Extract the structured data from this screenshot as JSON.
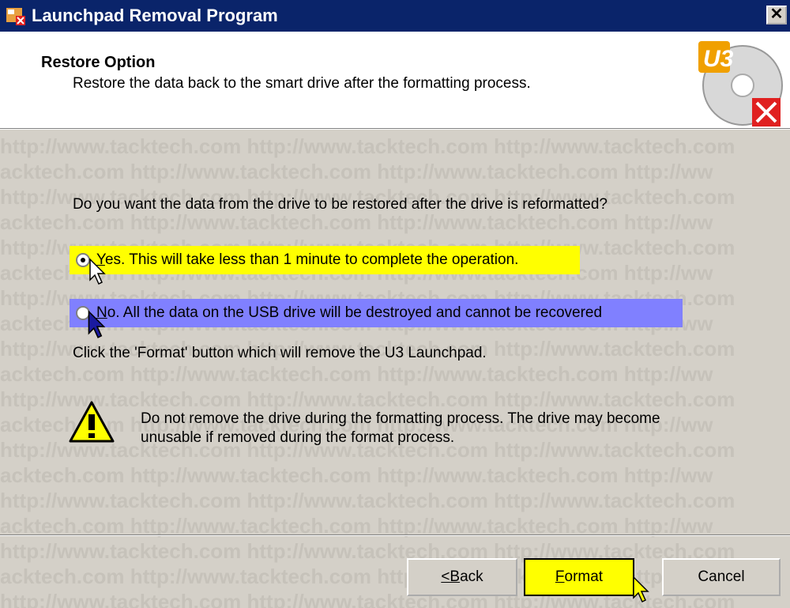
{
  "window": {
    "title": "Launchpad Removal Program",
    "close_glyph": "✕"
  },
  "header": {
    "title": "Restore Option",
    "subtitle": "Restore the data back to the smart drive after the formatting process.",
    "logo_icon": "u3-disc-remove-icon",
    "logo_text": "U3"
  },
  "content": {
    "question": "Do you want the data from the drive to be restored after the drive is reformatted?",
    "option_yes": {
      "accel": "Y",
      "rest": "es. This will take less than 1 minute to complete the operation.",
      "selected": true,
      "highlight_color": "#ffff00"
    },
    "option_no": {
      "accel": "N",
      "rest": "o.  All the data on the USB drive will be destroyed and cannot be recovered",
      "selected": false,
      "highlight_color": "#8080ff"
    },
    "instruction": "Click the 'Format' button which will remove the U3 Launchpad.",
    "warning_icon": "warning-icon",
    "warning_line1": "Do not remove the drive during the formatting process. The drive may become",
    "warning_line2": "unusable if removed during the format process."
  },
  "watermark": {
    "line_a": "http://www.tacktech.com http://www.tacktech.com http://www.tacktech.com",
    "line_b": "acktech.com http://www.tacktech.com http://www.tacktech.com http://ww"
  },
  "buttons": {
    "back_accel": "<B",
    "back_rest": "ack",
    "format_accel": "F",
    "format_rest": "ormat",
    "cancel": "Cancel",
    "format_highlight": "#ffff00"
  }
}
